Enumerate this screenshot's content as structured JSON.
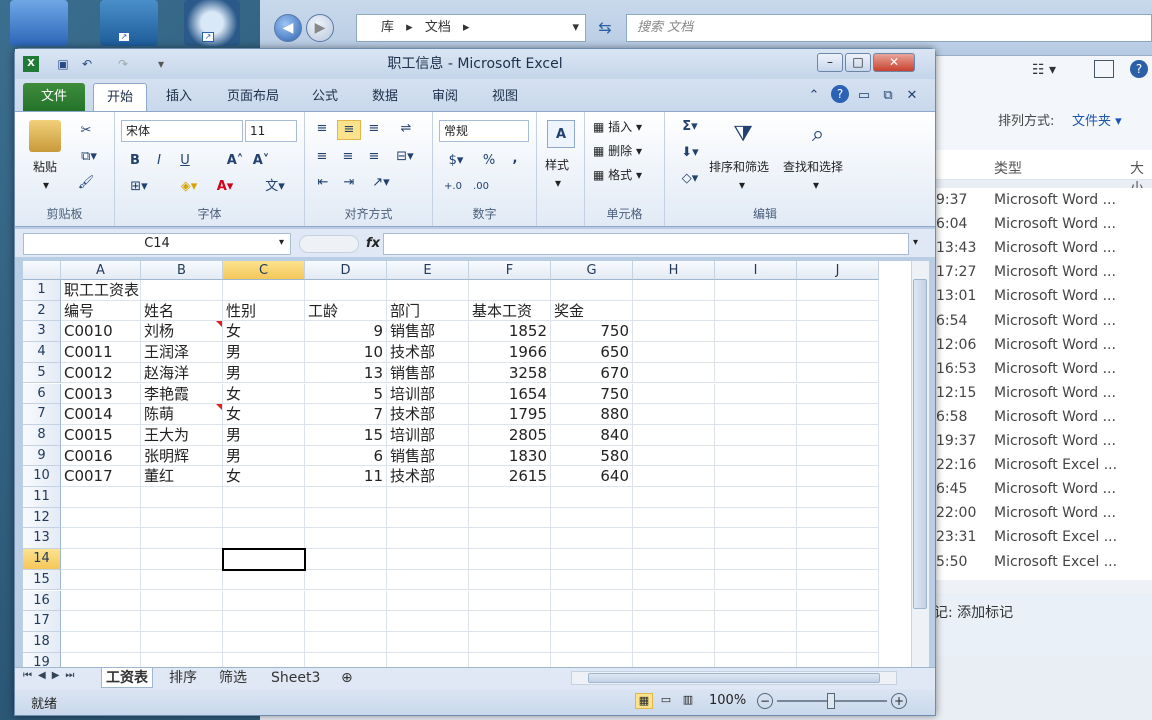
{
  "explorer": {
    "breadcrumb": [
      "库",
      "文档"
    ],
    "search_placeholder": "搜索 文档",
    "sort_label": "排列方式:",
    "sort_value": "文件夹",
    "col_type": "类型",
    "col_size": "大小",
    "rows": [
      {
        "time": "9:37",
        "type": "Microsoft Word ..."
      },
      {
        "time": "6:04",
        "type": "Microsoft Word ..."
      },
      {
        "time": "13:43",
        "type": "Microsoft Word ..."
      },
      {
        "time": "17:27",
        "type": "Microsoft Word ..."
      },
      {
        "time": "13:01",
        "type": "Microsoft Word ..."
      },
      {
        "time": "6:54",
        "type": "Microsoft Word ..."
      },
      {
        "time": "12:06",
        "type": "Microsoft Word ..."
      },
      {
        "time": "16:53",
        "type": "Microsoft Word ..."
      },
      {
        "time": "12:15",
        "type": "Microsoft Word ..."
      },
      {
        "time": "6:58",
        "type": "Microsoft Word ..."
      },
      {
        "time": "19:37",
        "type": "Microsoft Word ..."
      },
      {
        "time": "22:16",
        "type": "Microsoft Excel ..."
      },
      {
        "time": "6:45",
        "type": "Microsoft Word ..."
      },
      {
        "time": "22:00",
        "type": "Microsoft Word ..."
      },
      {
        "time": "23:31",
        "type": "Microsoft Excel ..."
      },
      {
        "time": "5:50",
        "type": "Microsoft Excel ..."
      }
    ],
    "tag_text": "记: 添加标记"
  },
  "excel": {
    "title": "职工信息 - Microsoft Excel",
    "tabs": [
      "文件",
      "开始",
      "插入",
      "页面布局",
      "公式",
      "数据",
      "审阅",
      "视图"
    ],
    "font_name": "宋体",
    "font_size": "11",
    "number_format": "常规",
    "groups": {
      "clipboard": "剪贴板",
      "font": "字体",
      "align": "对齐方式",
      "number": "数字",
      "cells": "单元格",
      "editing": "编辑"
    },
    "buttons": {
      "paste": "粘贴",
      "styles": "样式",
      "insert": "插入",
      "delete": "删除",
      "format": "格式",
      "sort_filter": "排序和筛选",
      "find_select": "查找和选择",
      "bold": "B",
      "italic": "I",
      "underline": "U",
      "percent": "%",
      "comma": ",",
      "sigma": "Σ"
    },
    "name_box": "C14",
    "fx": "fx",
    "columns": [
      "A",
      "B",
      "C",
      "D",
      "E",
      "F",
      "G",
      "H",
      "I",
      "J"
    ],
    "rows": [
      "1",
      "2",
      "3",
      "4",
      "5",
      "6",
      "7",
      "8",
      "9",
      "10",
      "11",
      "12",
      "13",
      "14",
      "15",
      "16",
      "17",
      "18",
      "19"
    ],
    "title_cell": "职工工资表",
    "headers": [
      "编号",
      "姓名",
      "性别",
      "工龄",
      "部门",
      "基本工资",
      "奖金"
    ],
    "data": [
      [
        "C0010",
        "刘杨",
        "女",
        "9",
        "销售部",
        "1852",
        "750"
      ],
      [
        "C0011",
        "王润泽",
        "男",
        "10",
        "技术部",
        "1966",
        "650"
      ],
      [
        "C0012",
        "赵海洋",
        "男",
        "13",
        "销售部",
        "3258",
        "670"
      ],
      [
        "C0013",
        "李艳霞",
        "女",
        "5",
        "培训部",
        "1654",
        "750"
      ],
      [
        "C0014",
        "陈萌",
        "女",
        "7",
        "技术部",
        "1795",
        "880"
      ],
      [
        "C0015",
        "王大为",
        "男",
        "15",
        "培训部",
        "2805",
        "840"
      ],
      [
        "C0016",
        "张明辉",
        "男",
        "6",
        "销售部",
        "1830",
        "580"
      ],
      [
        "C0017",
        "董红",
        "女",
        "11",
        "技术部",
        "2615",
        "640"
      ]
    ],
    "sheets": [
      "工资表",
      "排序",
      "筛选",
      "Sheet3"
    ],
    "status": "就绪",
    "zoom": "100%"
  }
}
